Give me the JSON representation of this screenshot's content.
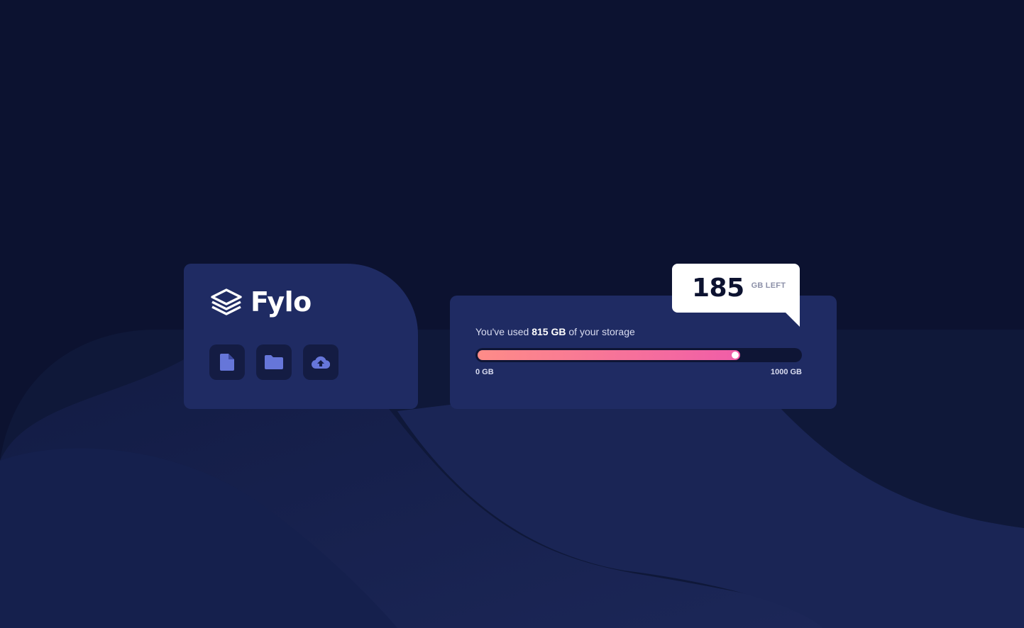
{
  "brand": {
    "name": "Fylo",
    "logo_icon": "stacked-layers-icon"
  },
  "toolbar": {
    "buttons": [
      {
        "icon": "document-icon",
        "label": "document"
      },
      {
        "icon": "folder-icon",
        "label": "folder"
      },
      {
        "icon": "cloud-upload-icon",
        "label": "upload"
      }
    ]
  },
  "storage": {
    "usage_prefix": "You've used ",
    "used_amount": "815 GB",
    "usage_suffix": " of your storage",
    "used_fraction": 0.815,
    "min_label": "0 GB",
    "max_label": "1000 GB",
    "remaining_value": "185",
    "remaining_unit": "GB LEFT"
  },
  "colors": {
    "background": "#0c1230",
    "card": "#1f2b63",
    "accent_start": "#fe8c88",
    "accent_end": "#f05da8",
    "icon": "#6676d9"
  }
}
